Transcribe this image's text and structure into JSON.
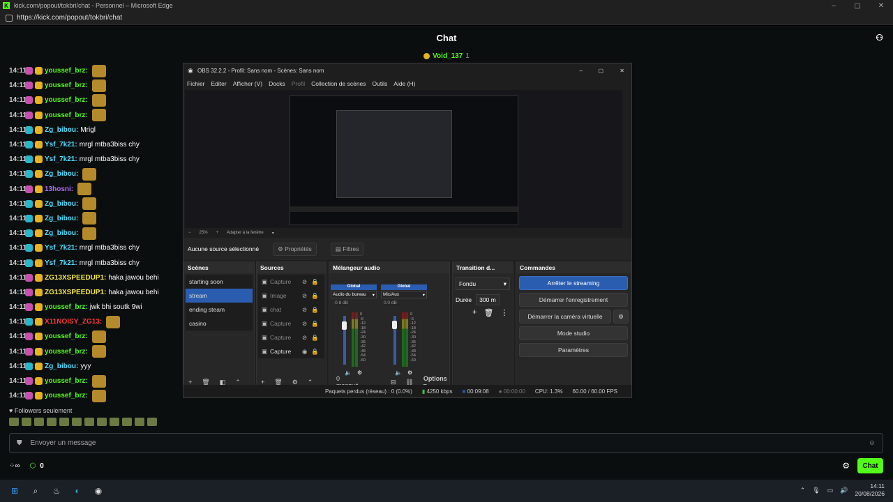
{
  "edge": {
    "title": "kick.com/popout/tokbri/chat - Personnel – Microsoft Edge",
    "url": "https://kick.com/popout/tokbri/chat"
  },
  "chat": {
    "header": "Chat",
    "pinned_user": "Void_137",
    "pinned_count": "1",
    "messages": [
      {
        "time": "14:11",
        "user": "youssef_brz:",
        "text": "",
        "color": "#53fc18",
        "badge": "#c84fae",
        "emote": true
      },
      {
        "time": "14:11",
        "user": "youssef_brz:",
        "text": "",
        "color": "#53fc18",
        "badge": "#c84fae",
        "emote": true
      },
      {
        "time": "14:11",
        "user": "youssef_brz:",
        "text": "",
        "color": "#53fc18",
        "badge": "#c84fae",
        "emote": true
      },
      {
        "time": "14:11",
        "user": "youssef_brz:",
        "text": "",
        "color": "#53fc18",
        "badge": "#c84fae",
        "emote": true
      },
      {
        "time": "14:11",
        "user": "Zg_bibou:",
        "text": "Mrigl",
        "color": "#53e0ff",
        "badge": "#29b6c9",
        "emote": false
      },
      {
        "time": "14:11",
        "user": "Ysf_7k21:",
        "text": "mrgl mtba3biss chy",
        "color": "#53e0ff",
        "badge": "#29b6c9",
        "emote": false
      },
      {
        "time": "14:11",
        "user": "Ysf_7k21:",
        "text": "mrgl mtba3biss chy",
        "color": "#53e0ff",
        "badge": "#29b6c9",
        "emote": false
      },
      {
        "time": "14:11",
        "user": "Zg_bibou:",
        "text": "",
        "color": "#53e0ff",
        "badge": "#29b6c9",
        "emote": true
      },
      {
        "time": "14:11",
        "user": "13hosni:",
        "text": "",
        "color": "#b26bff",
        "badge": "#c84fae",
        "emote": true
      },
      {
        "time": "14:11",
        "user": "Zg_bibou:",
        "text": "",
        "color": "#53e0ff",
        "badge": "#29b6c9",
        "emote": true
      },
      {
        "time": "14:11",
        "user": "Zg_bibou:",
        "text": "",
        "color": "#53e0ff",
        "badge": "#29b6c9",
        "emote": true
      },
      {
        "time": "14:11",
        "user": "Zg_bibou:",
        "text": "",
        "color": "#53e0ff",
        "badge": "#29b6c9",
        "emote": true
      },
      {
        "time": "14:11",
        "user": "Ysf_7k21:",
        "text": "mrgl mtba3biss chy",
        "color": "#53e0ff",
        "badge": "#29b6c9",
        "emote": false
      },
      {
        "time": "14:11",
        "user": "Ysf_7k21:",
        "text": "mrgl mtba3biss chy",
        "color": "#53e0ff",
        "badge": "#29b6c9",
        "emote": false
      },
      {
        "time": "14:11",
        "user": "ZG13XSPEEDUP1:",
        "text": "haka jawou behi",
        "color": "#f5e642",
        "badge": "#c84fae",
        "emote": false
      },
      {
        "time": "14:11",
        "user": "ZG13XSPEEDUP1:",
        "text": "haka jawou behi",
        "color": "#f5e642",
        "badge": "#c84fae",
        "emote": false
      },
      {
        "time": "14:11",
        "user": "youssef_brz:",
        "text": "jwk bhi soutk 9wi",
        "color": "#53fc18",
        "badge": "#c84fae",
        "emote": false
      },
      {
        "time": "14:11",
        "user": "X11NOISY_ZG13:",
        "text": "",
        "color": "#ff3b3b",
        "badge": "#29b6c9",
        "emote": true
      },
      {
        "time": "14:11",
        "user": "youssef_brz:",
        "text": "",
        "color": "#53fc18",
        "badge": "#c84fae",
        "emote": true
      },
      {
        "time": "14:11",
        "user": "youssef_brz:",
        "text": "",
        "color": "#53fc18",
        "badge": "#c84fae",
        "emote": true
      },
      {
        "time": "14:11",
        "user": "Zg_bibou:",
        "text": "yyy",
        "color": "#53e0ff",
        "badge": "#29b6c9",
        "emote": false
      },
      {
        "time": "14:11",
        "user": "youssef_brz:",
        "text": "",
        "color": "#53fc18",
        "badge": "#c84fae",
        "emote": true
      },
      {
        "time": "14:11",
        "user": "youssef_brz:",
        "text": "",
        "color": "#53fc18",
        "badge": "#c84fae",
        "emote": true
      }
    ],
    "followers_only": "Followers seulement",
    "input_placeholder": "Envoyer un message",
    "viewer_count": "0",
    "send_label": "Chat"
  },
  "obs": {
    "title": "OBS 32.2.2 - Profil: Sans nom - Scènes: Sans nom",
    "menu": [
      "Fichier",
      "Editer",
      "Afficher (V)",
      "Docks",
      "Profil",
      "Collection de scènes",
      "Outils",
      "Aide (H)"
    ],
    "zoom": "25%",
    "fit": "Adapter à la fenêtre",
    "no_source": "Aucune source sélectionné",
    "properties": "Propriétés",
    "filters": "Filtres",
    "scenes_title": "Scènes",
    "scenes": [
      "starting soon",
      "stream",
      "ending steam",
      "casino"
    ],
    "selected_scene": 1,
    "sources_title": "Sources",
    "sources": [
      "Capture",
      "Image",
      "chat",
      "Capture",
      "Capture",
      "Capture"
    ],
    "mixer_title": "Mélangeur audio",
    "mixer": [
      {
        "head": "Global",
        "device": "Audio du bureau",
        "db": "-0.8 dB",
        "level": 0.88
      },
      {
        "head": "Global",
        "device": "Mic/Aux",
        "db": "0.0 dB",
        "level": 0.9
      }
    ],
    "mixer_scale": [
      "0",
      "-6",
      "-12",
      "-18",
      "-24",
      "-30",
      "-36",
      "-42",
      "-48",
      "-54",
      "-60"
    ],
    "masked": "0 masqué",
    "options": "Options",
    "transition_title": "Transition d...",
    "transition": "Fondu",
    "duration_label": "Durée",
    "duration": "300 m",
    "commands_title": "Commandes",
    "commands": [
      "Arrêter le streaming",
      "Démarrer l'enregistrement",
      "Démarrer la caméra virtuelle",
      "Mode studio",
      "Paramètres"
    ],
    "status": {
      "dropped": "Paquets perdus (réseau) : 0 (0.0%)",
      "bitrate": "4250 kbps",
      "stream_time": "00:09:08",
      "rec_time": "00:00:00",
      "cpu": "CPU: 1.3%",
      "fps": "60.00 / 60.00 FPS"
    }
  },
  "taskbar": {
    "time": "14:11",
    "date": "20/08/2026"
  }
}
